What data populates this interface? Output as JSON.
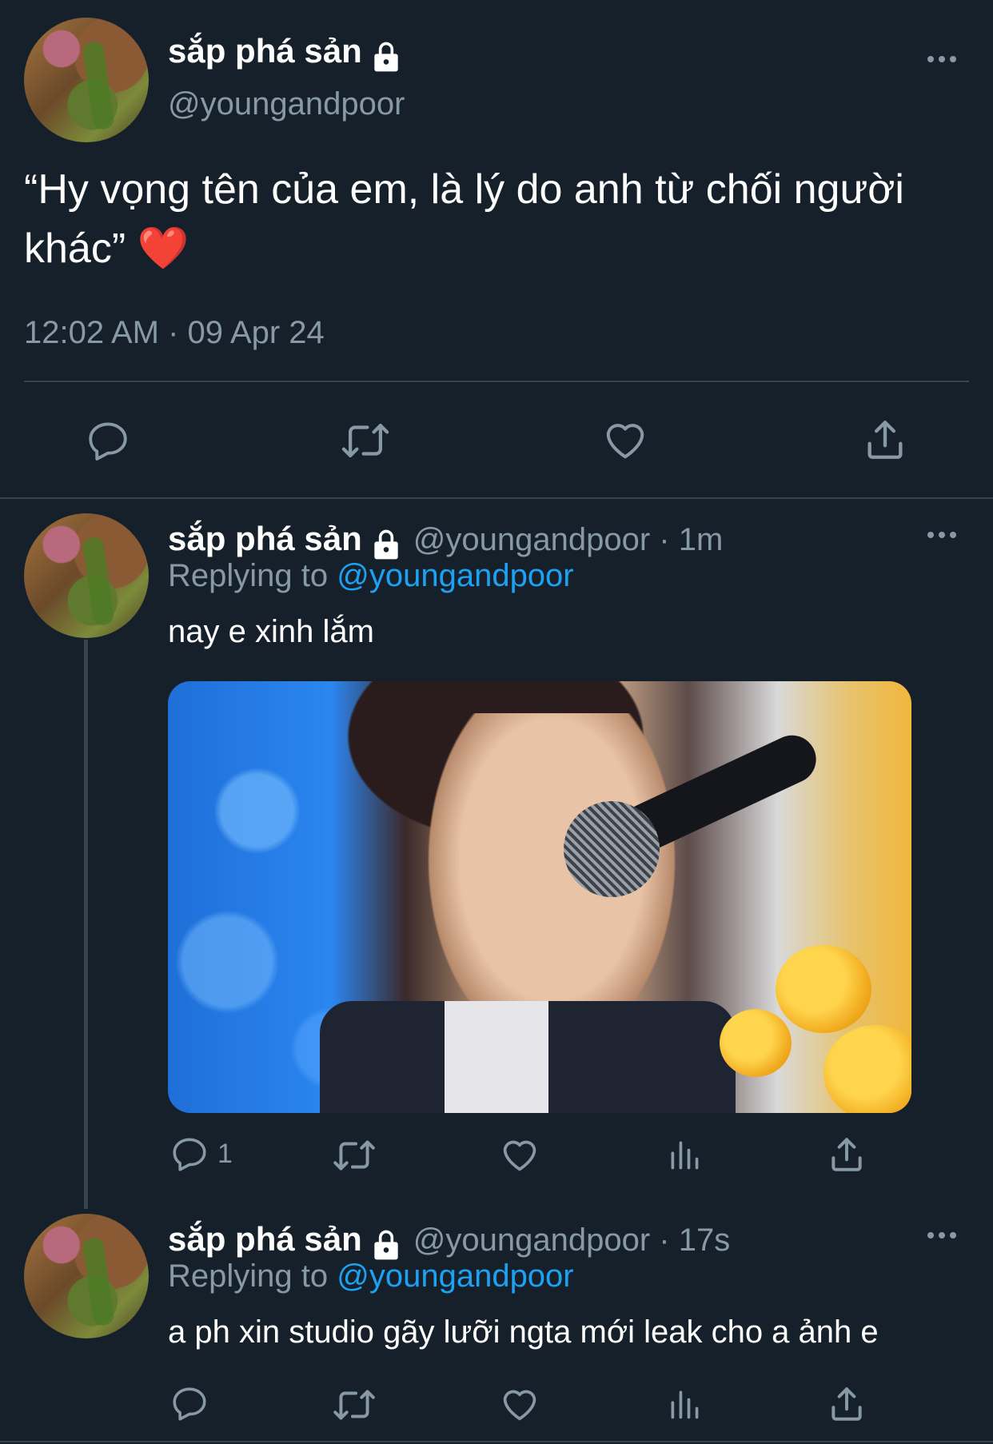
{
  "main_tweet": {
    "display_name": "sắp phá sản",
    "handle": "@youngandpoor",
    "text_line1": "“Hy vọng tên của em, là lý do anh từ chối người",
    "text_line2": "khác” ❤️",
    "timestamp": "12:02 AM · 09 Apr 24",
    "actions": [
      "reply-icon",
      "retweet-icon",
      "like-icon",
      "share-icon"
    ]
  },
  "reply1": {
    "display_name": "sắp phá sản",
    "handle": "@youngandpoor",
    "time_sep": " · 1m",
    "replying_prefix": "Replying to ",
    "replying_to": "@youngandpoor",
    "text": "nay e xinh lắm",
    "reply_count": "1",
    "actions": [
      "reply-icon",
      "retweet-icon",
      "like-icon",
      "analytics-icon",
      "share-icon"
    ]
  },
  "reply2": {
    "display_name": "sắp phá sản",
    "handle": "@youngandpoor",
    "time_sep": " · 17s",
    "replying_prefix": "Replying to ",
    "replying_to": "@youngandpoor",
    "text": "a ph xin studio gãy lưỡi ngta mới leak cho a ảnh e",
    "actions": [
      "reply-icon",
      "retweet-icon",
      "like-icon",
      "analytics-icon",
      "share-icon"
    ]
  },
  "colors": {
    "background": "#15202b",
    "secondary_text": "#8899a6",
    "link": "#1da1f2",
    "divider": "#38444d"
  }
}
